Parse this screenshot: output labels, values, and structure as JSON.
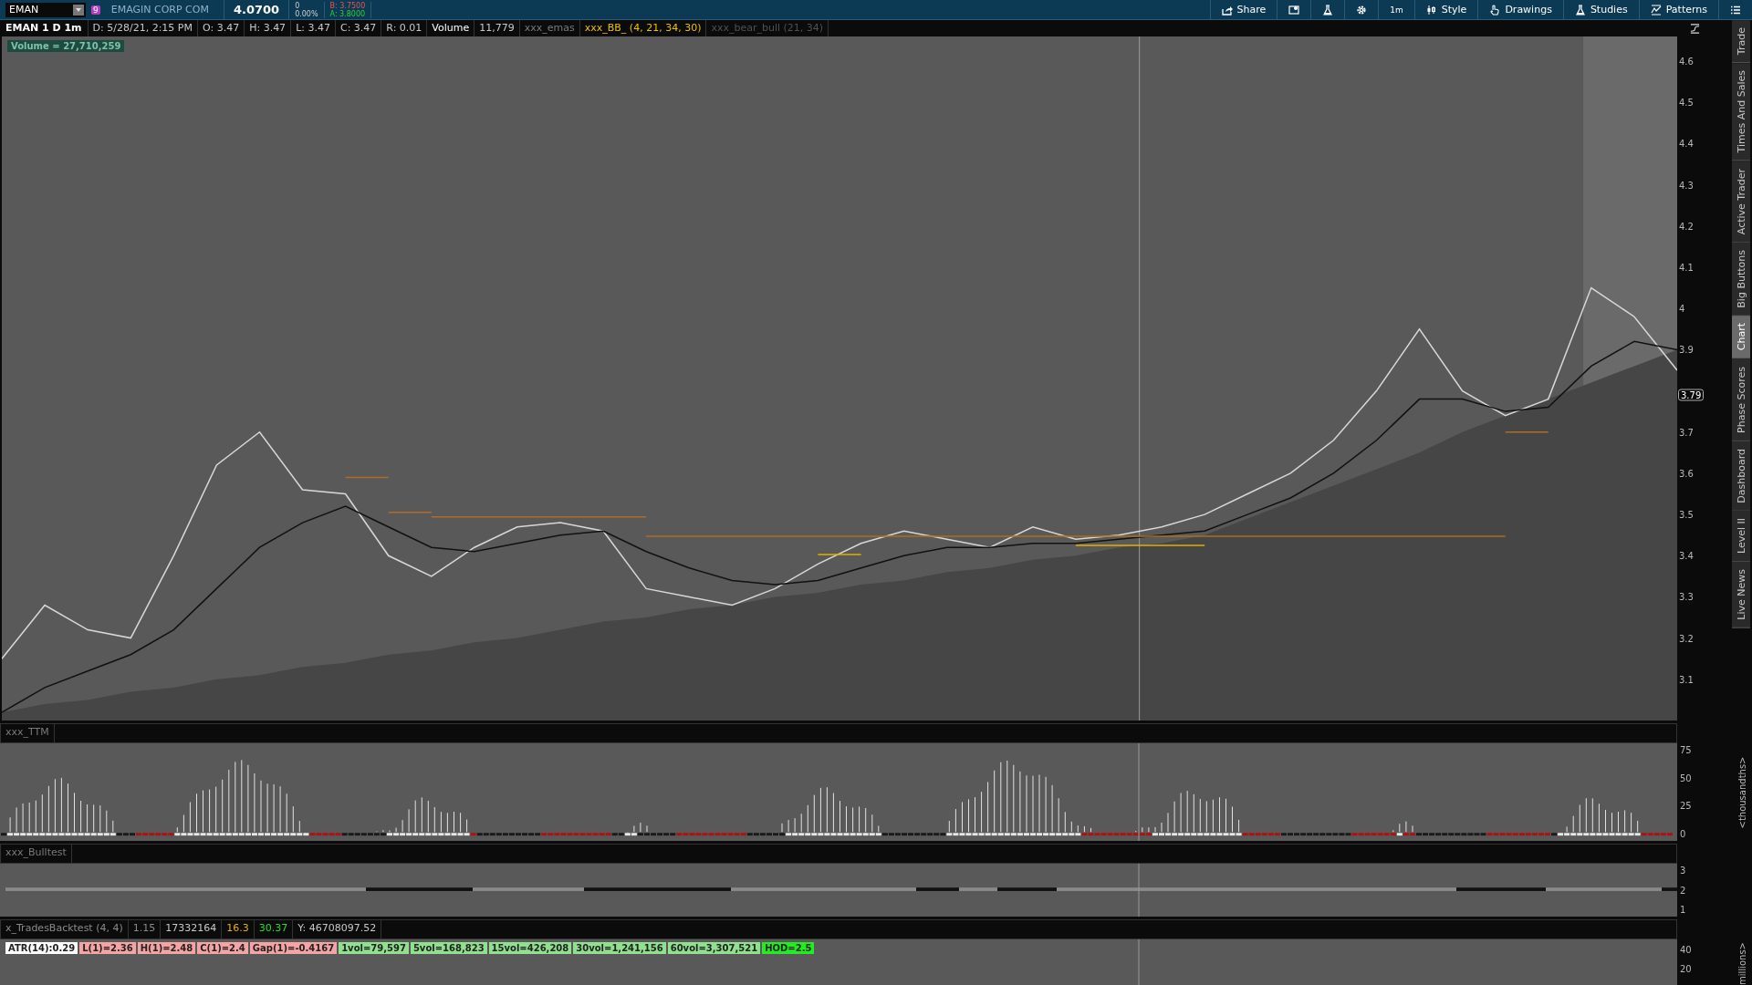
{
  "toolbar": {
    "symbol": "EMAN",
    "badge": "9",
    "company": "EMAGIN CORP COM",
    "last": "4.0700",
    "change": "0",
    "change_pct": "0.00%",
    "bid": "B: 3.7500",
    "ask": "A: 3.8000",
    "buttons": [
      {
        "kind": "share",
        "label": "Share"
      },
      {
        "kind": "screen"
      },
      {
        "kind": "flask"
      },
      {
        "kind": "gear"
      },
      {
        "kind": "text",
        "label": "1m"
      },
      {
        "kind": "style",
        "label": "Style"
      },
      {
        "kind": "hand",
        "label": "Drawings"
      },
      {
        "kind": "flask",
        "label": "Studies"
      },
      {
        "kind": "pattern",
        "label": "Patterns"
      },
      {
        "kind": "menu"
      }
    ]
  },
  "info_bar": {
    "title": "EMAN 1 D 1m",
    "cells": [
      {
        "text": "D: 5/28/21, 2:15 PM",
        "kind": "value"
      },
      {
        "text": "O: 3.47",
        "kind": "value"
      },
      {
        "text": "H: 3.47",
        "kind": "value"
      },
      {
        "text": "L: 3.47",
        "kind": "value"
      },
      {
        "text": "C: 3.47",
        "kind": "value"
      },
      {
        "text": "R: 0.01",
        "kind": "value"
      },
      {
        "text": "Volume",
        "kind": "label"
      },
      {
        "text": "11,779",
        "kind": "value"
      },
      {
        "text": "xxx_emas",
        "kind": "study"
      },
      {
        "text": "xxx_BB_ (4, 21, 34, 30)",
        "kind": "highlight"
      },
      {
        "text": "xxx_bear_bull (21, 34)",
        "kind": "hidden"
      }
    ]
  },
  "main_chart": {
    "volume_label": "Volume = 27,710,259",
    "price_tag": "3.79",
    "chart_data": {
      "type": "line",
      "ylim": [
        3.0,
        4.66
      ],
      "yticks": [
        {
          "value": 3.1,
          "label": "3.1"
        },
        {
          "value": 3.2,
          "label": "3.2"
        },
        {
          "value": 3.3,
          "label": "3.3"
        },
        {
          "value": 3.4,
          "label": "3.4"
        },
        {
          "value": 3.5,
          "label": "3.5"
        },
        {
          "value": 3.6,
          "label": "3.6"
        },
        {
          "value": 3.7,
          "label": "3.7"
        },
        {
          "value": 3.9,
          "label": "3.9"
        },
        {
          "value": 4,
          "label": "4"
        },
        {
          "value": 4.1,
          "label": "4.1"
        },
        {
          "value": 4.2,
          "label": "4.2"
        },
        {
          "value": 4.3,
          "label": "4.3"
        },
        {
          "value": 4.4,
          "label": "4.4"
        },
        {
          "value": 4.5,
          "label": "4.5"
        },
        {
          "value": 4.6,
          "label": "4.6"
        }
      ],
      "series": [
        {
          "type": "area",
          "color": "#464646",
          "values": [
            3.02,
            3.04,
            3.05,
            3.07,
            3.08,
            3.1,
            3.11,
            3.13,
            3.14,
            3.16,
            3.17,
            3.19,
            3.2,
            3.22,
            3.24,
            3.25,
            3.27,
            3.28,
            3.3,
            3.31,
            3.33,
            3.34,
            3.36,
            3.37,
            3.39,
            3.4,
            3.42,
            3.43,
            3.45,
            3.49,
            3.53,
            3.57,
            3.61,
            3.65,
            3.7,
            3.74,
            3.78,
            3.82,
            3.86,
            3.9
          ]
        },
        {
          "type": "line",
          "color": "#d8d8d8",
          "values": [
            3.15,
            3.28,
            3.22,
            3.2,
            3.4,
            3.62,
            3.7,
            3.56,
            3.55,
            3.4,
            3.35,
            3.42,
            3.47,
            3.48,
            3.46,
            3.32,
            3.3,
            3.28,
            3.32,
            3.38,
            3.43,
            3.46,
            3.44,
            3.42,
            3.47,
            3.44,
            3.45,
            3.47,
            3.5,
            3.55,
            3.6,
            3.68,
            3.8,
            3.95,
            3.8,
            3.74,
            3.78,
            4.05,
            3.98,
            3.85
          ]
        },
        {
          "type": "line",
          "color": "#111111",
          "values": [
            3.02,
            3.08,
            3.12,
            3.16,
            3.22,
            3.32,
            3.42,
            3.48,
            3.52,
            3.47,
            3.42,
            3.41,
            3.43,
            3.45,
            3.46,
            3.41,
            3.37,
            3.34,
            3.33,
            3.34,
            3.37,
            3.4,
            3.42,
            3.42,
            3.43,
            3.43,
            3.44,
            3.45,
            3.46,
            3.5,
            3.54,
            3.6,
            3.68,
            3.78,
            3.78,
            3.75,
            3.76,
            3.86,
            3.92,
            3.9
          ]
        },
        {
          "type": "line",
          "color": "#b06a2a",
          "values": [
            null,
            null,
            null,
            null,
            null,
            null,
            null,
            null,
            3.59,
            3.59,
            null,
            null,
            null,
            null,
            null,
            null,
            null,
            null,
            null,
            null,
            null,
            null,
            null,
            null,
            null,
            null,
            null,
            null,
            null,
            null,
            null,
            null,
            null,
            null,
            null,
            null,
            null,
            null,
            null,
            null
          ]
        },
        {
          "type": "line",
          "color": "#b06a2a",
          "values": [
            null,
            null,
            null,
            null,
            null,
            null,
            null,
            null,
            null,
            3.505,
            3.505,
            null,
            null,
            null,
            null,
            null,
            null,
            null,
            null,
            null,
            null,
            null,
            null,
            null,
            null,
            null,
            null,
            null,
            null,
            null,
            null,
            null,
            null,
            null,
            null,
            null,
            null,
            null,
            null,
            null
          ]
        },
        {
          "type": "line",
          "color": "#b06a2a",
          "values": [
            null,
            null,
            null,
            null,
            null,
            null,
            null,
            null,
            null,
            null,
            3.494,
            3.494,
            3.494,
            3.494,
            3.494,
            3.494,
            null,
            null,
            null,
            null,
            null,
            null,
            null,
            null,
            null,
            null,
            null,
            null,
            null,
            null,
            null,
            null,
            null,
            null,
            null,
            null,
            null,
            null,
            null,
            null
          ]
        },
        {
          "type": "line",
          "color": "#b06a2a",
          "values": [
            null,
            null,
            null,
            null,
            null,
            null,
            null,
            null,
            null,
            null,
            null,
            null,
            null,
            null,
            null,
            3.447,
            3.447,
            3.447,
            3.447,
            3.447,
            3.447,
            3.447,
            3.447,
            3.447,
            3.447,
            3.447,
            3.447,
            3.447,
            3.447,
            3.447,
            3.447,
            3.447,
            3.447,
            3.447,
            3.447,
            3.447,
            null,
            null,
            null,
            null
          ]
        },
        {
          "type": "line",
          "color": "#b06a2a",
          "values": [
            null,
            null,
            null,
            null,
            null,
            null,
            null,
            null,
            null,
            null,
            null,
            null,
            null,
            null,
            null,
            null,
            null,
            null,
            null,
            null,
            null,
            null,
            null,
            null,
            null,
            null,
            null,
            null,
            null,
            null,
            null,
            null,
            null,
            null,
            null,
            3.7,
            3.7,
            null,
            null,
            null
          ]
        },
        {
          "type": "line",
          "color": "#e0b000",
          "values": [
            null,
            null,
            null,
            null,
            null,
            null,
            null,
            null,
            null,
            null,
            null,
            null,
            null,
            null,
            null,
            null,
            null,
            null,
            null,
            3.403,
            3.403,
            null,
            null,
            null,
            null,
            null,
            null,
            null,
            null,
            null,
            null,
            null,
            null,
            null,
            null,
            null,
            null,
            null,
            null,
            null
          ]
        },
        {
          "type": "line",
          "color": "#e0b000",
          "values": [
            null,
            null,
            null,
            null,
            null,
            null,
            null,
            null,
            null,
            null,
            null,
            null,
            null,
            null,
            null,
            null,
            null,
            null,
            null,
            null,
            null,
            null,
            null,
            null,
            null,
            3.425,
            3.425,
            3.425,
            3.425,
            null,
            null,
            null,
            null,
            null,
            null,
            null,
            null,
            null,
            null,
            null
          ]
        }
      ]
    }
  },
  "side_tabs": [
    {
      "label": "Trade",
      "selected": false
    },
    {
      "label": "Times And Sales",
      "selected": false
    },
    {
      "label": "Active Trader",
      "selected": false
    },
    {
      "label": "Big Buttons",
      "selected": false
    },
    {
      "label": "Chart",
      "selected": true
    },
    {
      "label": "Phase Scores",
      "selected": false
    },
    {
      "label": "Dashboard",
      "selected": false
    },
    {
      "label": "Level II",
      "selected": false
    },
    {
      "label": "Live News",
      "selected": false
    }
  ],
  "ttm": {
    "title": "xxx_TTM",
    "ticks": [
      "75",
      "50",
      "25",
      "0"
    ],
    "unit": "<thousandths>"
  },
  "bulltest": {
    "title": "xxx_Bulltest",
    "ticks": [
      "3",
      "2",
      "1"
    ]
  },
  "backtest": {
    "title": "x_TradesBacktest (4, 4)",
    "cells": [
      {
        "text": "1.15",
        "color": "#8a8a8a"
      },
      {
        "text": "17332164",
        "color": "#c8c8c8"
      },
      {
        "text": "16.3",
        "color": "#e8b000"
      },
      {
        "text": "30.37",
        "color": "#20e020"
      },
      {
        "text": "Y: 46708097.52",
        "color": "#c8c8c8"
      }
    ],
    "ticks": [
      "40",
      "20"
    ],
    "unit": "millions>",
    "labels": [
      {
        "text": "ATR(14):0.29",
        "color": "#ffffff"
      },
      {
        "text": "L(1)=2.36",
        "color": "#f4a4a4"
      },
      {
        "text": "H(1)=2.48",
        "color": "#f4a4a4"
      },
      {
        "text": "C(1)=2.4",
        "color": "#f4a4a4"
      },
      {
        "text": "Gap(1)=-0.4167",
        "color": "#f4a4a4"
      },
      {
        "text": "1vol=79,597",
        "color": "#90e090"
      },
      {
        "text": "5vol=168,823",
        "color": "#90e090"
      },
      {
        "text": "15vol=426,208",
        "color": "#90e090"
      },
      {
        "text": "30vol=1,241,156",
        "color": "#90e090"
      },
      {
        "text": "60vol=3,307,521",
        "color": "#90e090"
      },
      {
        "text": "HOD=2.5",
        "color": "#20ee20"
      }
    ]
  }
}
